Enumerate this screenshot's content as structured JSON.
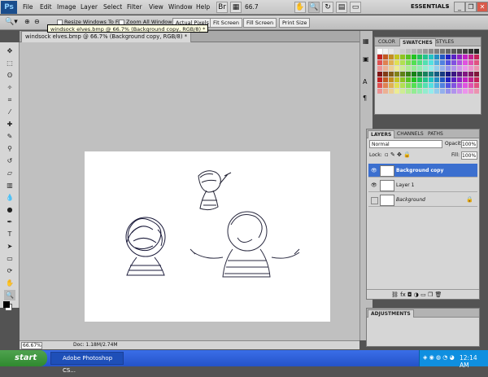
{
  "app": {
    "logo": "Ps",
    "workspace": "ESSENTIALS",
    "zoom_display": "66.7"
  },
  "menu": [
    "File",
    "Edit",
    "Image",
    "Layer",
    "Select",
    "Filter",
    "View",
    "Window",
    "Help"
  ],
  "options_bar": {
    "checkboxes": [
      "Resize Windows To Fit",
      "Zoom All Windows"
    ],
    "buttons": [
      "Actual Pixels",
      "Fit Screen",
      "Fill Screen",
      "Print Size"
    ]
  },
  "document": {
    "tab_title": "windsock elves.bmp @ 66.7% (Background copy, RGB/8) *",
    "tooltip": "windsock elves.bmp @ 66.7% (Background copy, RGB/8) *",
    "zoom_field": "66.67%",
    "doc_info": "Doc: 1.18M/2.74M"
  },
  "panels": {
    "color_tabs": [
      "COLOR",
      "SWATCHES",
      "STYLES"
    ],
    "layers_tabs": [
      "LAYERS",
      "CHANNELS",
      "PATHS"
    ],
    "blend_mode": "Normal",
    "opacity_label": "Opacity:",
    "opacity_value": "100%",
    "lock_label": "Lock:",
    "fill_label": "Fill:",
    "fill_value": "100%",
    "layers": [
      {
        "name": "Background copy",
        "selected": true,
        "visible": true
      },
      {
        "name": "Layer 1",
        "selected": false,
        "visible": true
      },
      {
        "name": "Background",
        "selected": false,
        "visible": false
      }
    ],
    "adjustments_tab": "ADJUSTMENTS"
  },
  "taskbar": {
    "start": "start",
    "task": "Adobe Photoshop CS...",
    "clock": "12:14 AM"
  },
  "colors": {
    "accent": "#3b6fcf",
    "taskbar": "#2453c9",
    "start": "#3b963b"
  }
}
